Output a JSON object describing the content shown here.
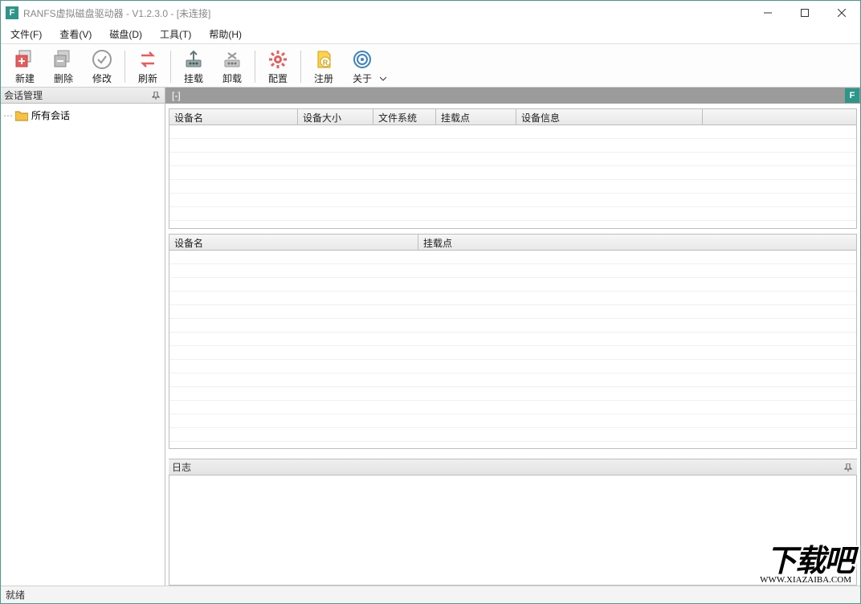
{
  "title": "RANFS虚拟磁盘驱动器 - V1.2.3.0 - [未连接]",
  "menu": {
    "file": "文件(F)",
    "view": "查看(V)",
    "disk": "磁盘(D)",
    "tool": "工具(T)",
    "help": "帮助(H)"
  },
  "toolbar": {
    "new": "新建",
    "delete": "删除",
    "modify": "修改",
    "refresh": "刷新",
    "mount": "挂载",
    "unmount": "卸载",
    "config": "配置",
    "register": "注册",
    "about": "关于"
  },
  "session": {
    "title": "会话管理",
    "root": "所有会话"
  },
  "tab": {
    "label": "[-]"
  },
  "grid1": {
    "cols": {
      "c1": "设备名",
      "c2": "设备大小",
      "c3": "文件系统",
      "c4": "挂载点",
      "c5": "设备信息"
    }
  },
  "grid2": {
    "cols": {
      "c1": "设备名",
      "c2": "挂载点"
    }
  },
  "log": {
    "title": "日志"
  },
  "status": {
    "text": "就绪"
  },
  "watermark": {
    "big": "下载吧",
    "small": "WWW.XIAZAIBA.COM"
  }
}
